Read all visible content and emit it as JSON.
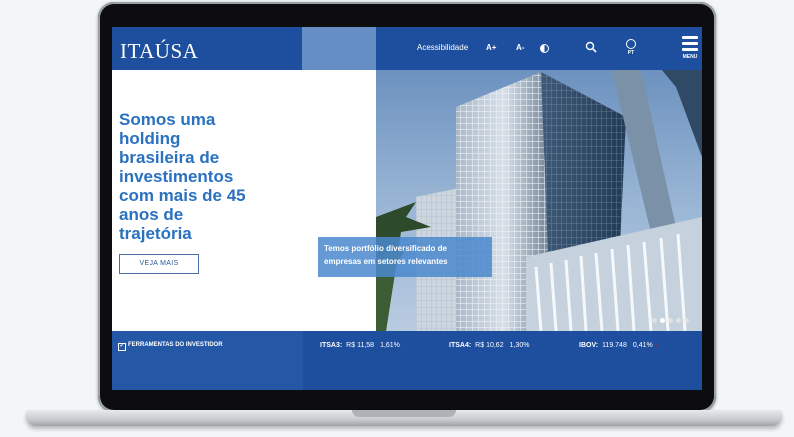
{
  "header": {
    "logo": "ITAÚSA",
    "accessibility": "Acessibilidade",
    "font_increase": "A+",
    "font_decrease": "A-",
    "language": "PT",
    "menu_label": "MENU"
  },
  "hero": {
    "title": "Somos uma\nholding\nbrasileira de\ninvestimentos\ncom mais de 45\nanos de\ntrajetória",
    "cta": "VEJA MAIS",
    "caption": "Temos portfólio diversificado de empresas em setores relevantes",
    "slides_count": 5,
    "active_slide": 2
  },
  "ticker": {
    "tools_label": "FERRAMENTAS DO INVESTIDOR",
    "quotes": [
      {
        "symbol": "ITSA3:",
        "value": "R$ 11,58",
        "change": "1,61%",
        "arrow": "↓"
      },
      {
        "symbol": "ITSA4:",
        "value": "R$ 10,62",
        "change": "1,30%",
        "arrow": "↓"
      },
      {
        "symbol": "IBOV:",
        "value": "119.748",
        "change": "0,41%",
        "arrow": "↓"
      }
    ]
  },
  "colors": {
    "brand_blue": "#1d4f9e",
    "title_blue": "#2a71c0",
    "caption_blue": "#4a88ce",
    "down_red": "#d22222"
  }
}
